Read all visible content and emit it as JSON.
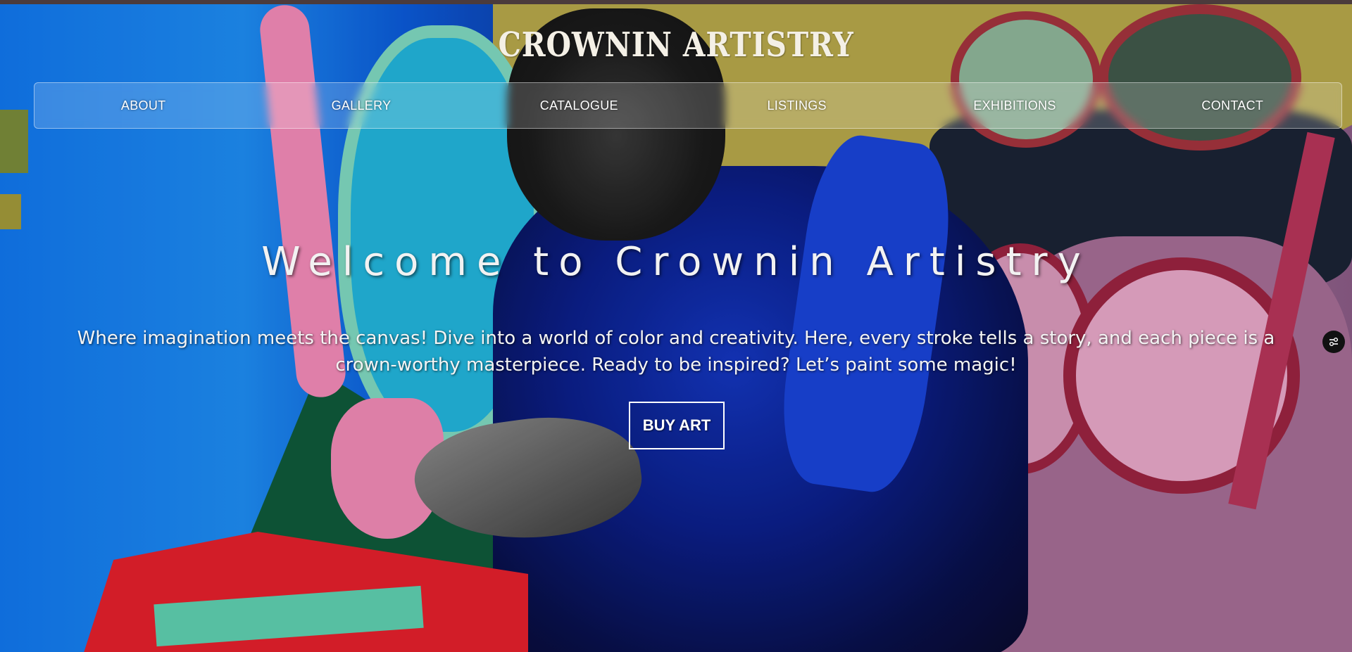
{
  "site": {
    "title": "CROWNIN ARTISTRY"
  },
  "nav": {
    "items": [
      {
        "label": "ABOUT"
      },
      {
        "label": "GALLERY"
      },
      {
        "label": "CATALOGUE"
      },
      {
        "label": "LISTINGS"
      },
      {
        "label": "EXHIBITIONS"
      },
      {
        "label": "CONTACT"
      }
    ]
  },
  "hero": {
    "heading": "Welcome to Crownin Artistry",
    "subtitle": "Where imagination meets the canvas! Dive into a world of color and creativity. Here, every stroke tells a story, and each piece is a crown-worthy masterpiece. Ready to be inspired? Let’s paint some magic!",
    "cta_label": "BUY ART"
  },
  "widgets": {
    "accessibility_icon": "settings-toggle-icon"
  },
  "colors": {
    "nav_text": "#ffffff",
    "title_text": "#f4f0e6",
    "button_border": "#ffffff"
  }
}
